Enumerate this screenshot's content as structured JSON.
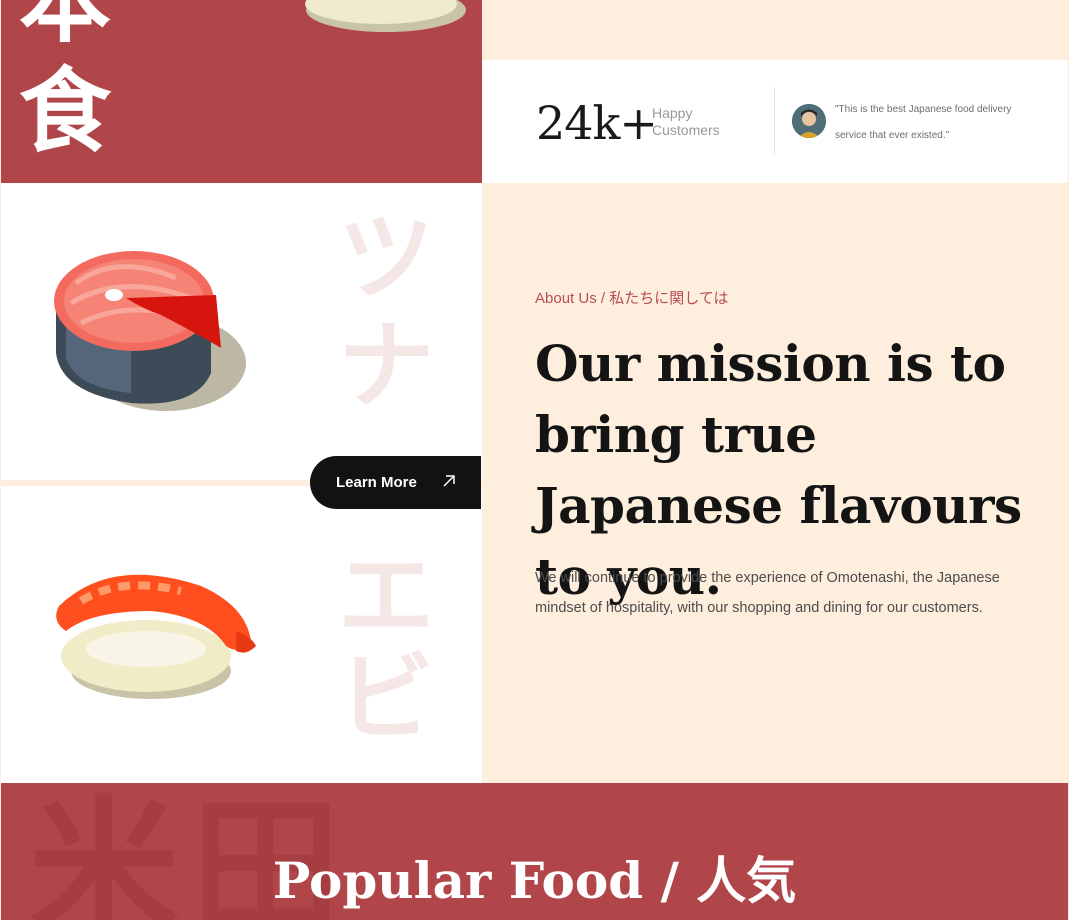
{
  "hero": {
    "kanji_top": "本",
    "kanji_bottom": "食"
  },
  "stats": {
    "number": "24k+",
    "label_line1": "Happy",
    "label_line2": "Customers",
    "quote": "\"This is the best Japanese food delivery service that ever existed.\""
  },
  "gallery": {
    "tuna_katakana_1": "ツ",
    "tuna_katakana_2": "ナ",
    "shrimp_katakana_1": "エ",
    "shrimp_katakana_2": "ビ",
    "learn_more_label": "Learn More",
    "arrow_icon": "arrow-up-right-icon"
  },
  "about": {
    "eyebrow": "About Us / 私たちに関しては",
    "headline": "Our mission is to bring true Japanese flavours to you.",
    "description": "We will continue to provide the experience of Omotenashi, the Japanese mindset of hospitality, with our shopping and dining for our customers."
  },
  "popular": {
    "title_en": "Popular Food / ",
    "title_jp": "人気",
    "bg_kanji_1": "米",
    "bg_kanji_2": "田"
  },
  "colors": {
    "brand_red": "#b0454a",
    "cream": "#fdeedd",
    "dark": "#121212",
    "accent_text": "#b84e58"
  }
}
